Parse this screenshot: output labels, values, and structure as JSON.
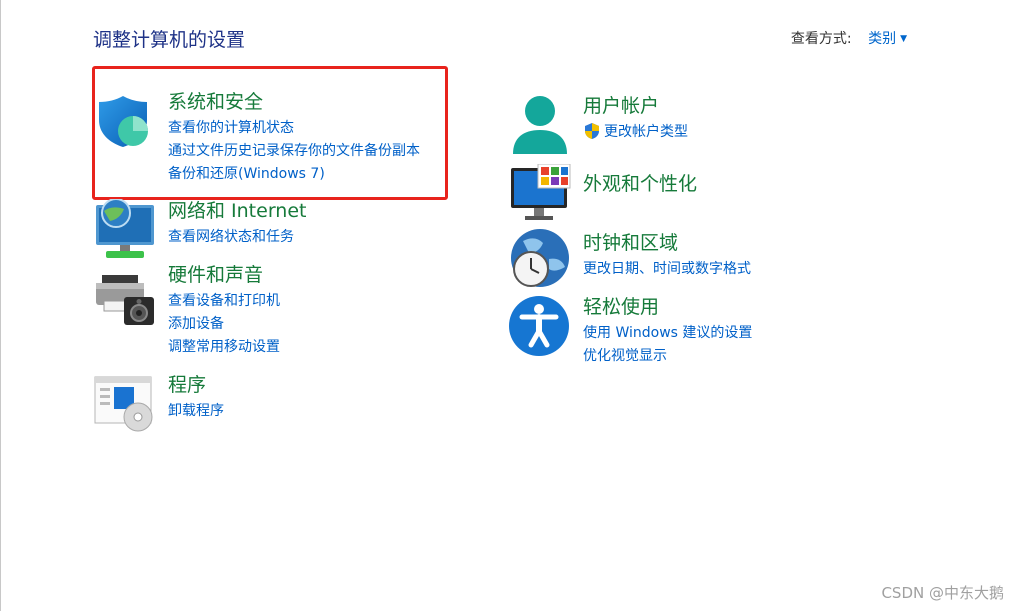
{
  "page": {
    "title": "调整计算机的设置",
    "view_by_label": "查看方式:",
    "view_by_value": "类别"
  },
  "categories_left": [
    {
      "title": "系统和安全",
      "icon": "shield-icon",
      "links": [
        "查看你的计算机状态",
        "通过文件历史记录保存你的文件备份副本",
        "备份和还原(Windows 7)"
      ]
    },
    {
      "title": "网络和 Internet",
      "icon": "network-globe-icon",
      "links": [
        "查看网络状态和任务"
      ]
    },
    {
      "title": "硬件和声音",
      "icon": "printer-speaker-icon",
      "links": [
        "查看设备和打印机",
        "添加设备",
        "调整常用移动设置"
      ]
    },
    {
      "title": "程序",
      "icon": "programs-icon",
      "links": [
        "卸载程序"
      ]
    }
  ],
  "categories_right": [
    {
      "title": "用户帐户",
      "icon": "user-icon",
      "links": [
        "更改帐户类型"
      ]
    },
    {
      "title": "外观和个性化",
      "icon": "monitor-icon",
      "links": []
    },
    {
      "title": "时钟和区域",
      "icon": "clock-globe-icon",
      "links": [
        "更改日期、时间或数字格式"
      ]
    },
    {
      "title": "轻松使用",
      "icon": "accessibility-icon",
      "links": [
        "使用 Windows 建议的设置",
        "优化视觉显示"
      ]
    }
  ],
  "highlight_color": "#e8231c",
  "watermark": "CSDN @中东大鹅"
}
